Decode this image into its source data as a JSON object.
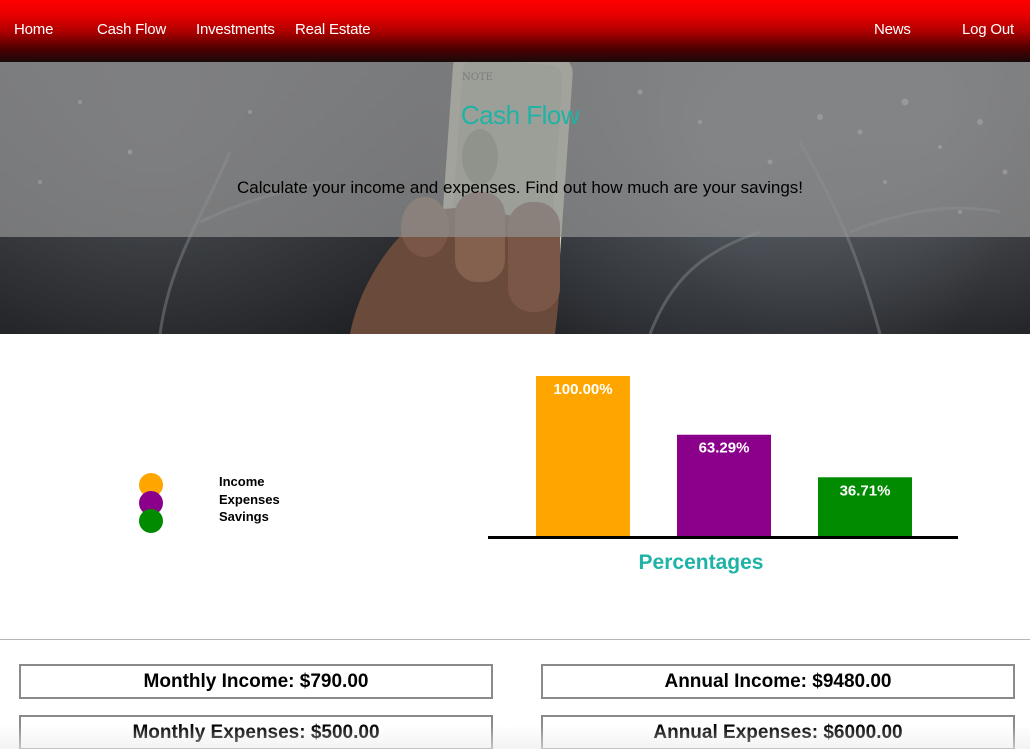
{
  "nav": {
    "home": "Home",
    "cash_flow": "Cash Flow",
    "investments": "Investments",
    "real_estate": "Real Estate",
    "news": "News",
    "log_out": "Log Out"
  },
  "hero": {
    "title": "Cash Flow",
    "subtitle": "Calculate your income and expenses. Find out how much are your savings!"
  },
  "legend": [
    {
      "label": "Income",
      "color": "#ffa500"
    },
    {
      "label": "Expenses",
      "color": "#8b008b"
    },
    {
      "label": "Savings",
      "color": "#008b00"
    }
  ],
  "chart_data": {
    "type": "bar",
    "categories": [
      "Income",
      "Expenses",
      "Savings"
    ],
    "values": [
      100.0,
      63.29,
      36.71
    ],
    "value_labels": [
      "100.00%",
      "63.29%",
      "36.71%"
    ],
    "colors": [
      "#ffa500",
      "#8b008b",
      "#008b00"
    ],
    "title": "Percentages",
    "title_color": "#1fb3a6",
    "ylim": [
      0,
      100
    ],
    "grid": false
  },
  "summary": {
    "monthly_income": "Monthly Income: $790.00",
    "annual_income": "Annual Income: $9480.00",
    "monthly_expenses": "Monthly Expenses: $500.00",
    "annual_expenses": "Annual Expenses: $6000.00"
  }
}
